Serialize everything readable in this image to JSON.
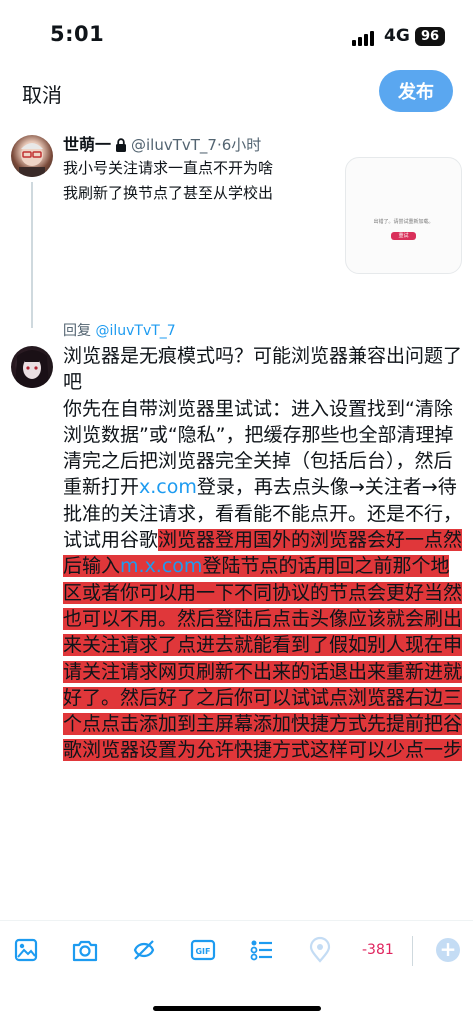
{
  "status_bar": {
    "time": "5:01",
    "network": "4G",
    "battery": "96"
  },
  "header": {
    "cancel_label": "取消",
    "publish_label": "发布"
  },
  "original_tweet": {
    "name": "世萌一",
    "handle": "@iluvTvT_7",
    "time": "·6小时",
    "lines": [
      "我小号关注请求一直点不开为啥",
      "我刷新了换节点了甚至从学校出"
    ],
    "thumbnail": {
      "text": "出错了。请尝试重新加载。",
      "button": "重试"
    }
  },
  "reply_to": {
    "prefix": "回复 ",
    "handle": "@iluvTvT_7"
  },
  "compose": {
    "p1": "浏览器是无痕模式吗？可能浏览器兼容出问题了吧",
    "p2a": "你先在自带浏览器里试试：进入设置找到“清除浏览数据”或“隐私”，把缓存那些也全部清理掉清完之后把浏览器完全关掉（包括后台），然后重新打开",
    "link1": "x.com",
    "p2b": "登录，再去点头像→关注者→待批准的关注请求，看看能不能点开。还是不行，试试用谷歌",
    "hl1": "浏览器登用国外的浏览器会好一点然后输入",
    "link2": "m.x.com",
    "hl2": "登陆节点的话用回之前那个地区或者你可以用一下不同协议的节点会更好当然也可以不用。然后登陆后点击头像应该就会刷出来关注请求了点进去就能看到了假如别人现在申请关注请求网页刷新不出来的话退出来重新进就好了。然后好了之后你可以试试点浏览器右边三个点点击添加到主屏幕添加快捷方式先提前把谷歌浏览器设置为允许快捷方式这样可以少点一步"
  },
  "toolbar": {
    "icons": [
      "image-icon",
      "camera-icon",
      "no-ai-icon",
      "gif-icon",
      "poll-icon",
      "location-icon"
    ],
    "char_count": "-381",
    "add_label": "+"
  },
  "colors": {
    "accent": "#1d9bf0",
    "publish_bg": "#5aa7f0",
    "highlight": "#e0373a",
    "count": "#e0245e"
  }
}
